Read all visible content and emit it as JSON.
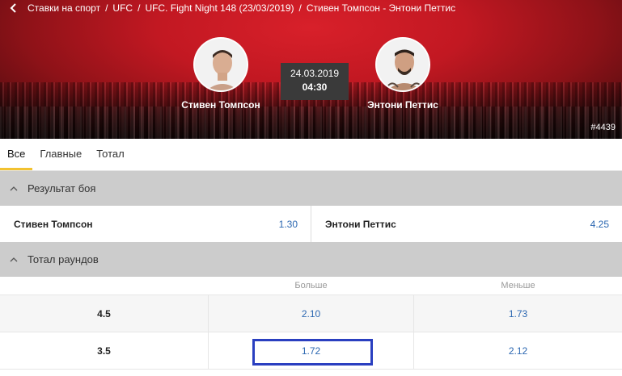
{
  "breadcrumb": {
    "items": [
      "Ставки на спорт",
      "UFC",
      "UFC. Fight Night 148 (23/03/2019)",
      "Стивен Томпсон - Энтони Петтис"
    ],
    "separator": "/"
  },
  "match": {
    "fighter1": "Стивен Томпсон",
    "fighter2": "Энтони Петтис",
    "date": "24.03.2019",
    "time": "04:30",
    "event_id": "#4439"
  },
  "tabs": [
    {
      "label": "Все",
      "active": true
    },
    {
      "label": "Главные",
      "active": false
    },
    {
      "label": "Тотал",
      "active": false
    }
  ],
  "markets": {
    "result": {
      "title": "Результат боя",
      "options": [
        {
          "name": "Стивен Томпсон",
          "odd": "1.30"
        },
        {
          "name": "Энтони Петтис",
          "odd": "4.25"
        }
      ]
    },
    "total_rounds": {
      "title": "Тотал раундов",
      "columns": [
        "",
        "Больше",
        "Меньше"
      ],
      "rows": [
        {
          "line": "4.5",
          "over": "2.10",
          "under": "1.73"
        },
        {
          "line": "3.5",
          "over": "1.72",
          "under": "2.12"
        }
      ]
    }
  },
  "colors": {
    "accent_tab": "#f2c230",
    "odd_text": "#2b67b1",
    "highlight": "#2a3fc0",
    "banner": "#c21822"
  },
  "icons": {
    "back": "chevron-left-icon",
    "collapse": "chevron-up-icon"
  }
}
